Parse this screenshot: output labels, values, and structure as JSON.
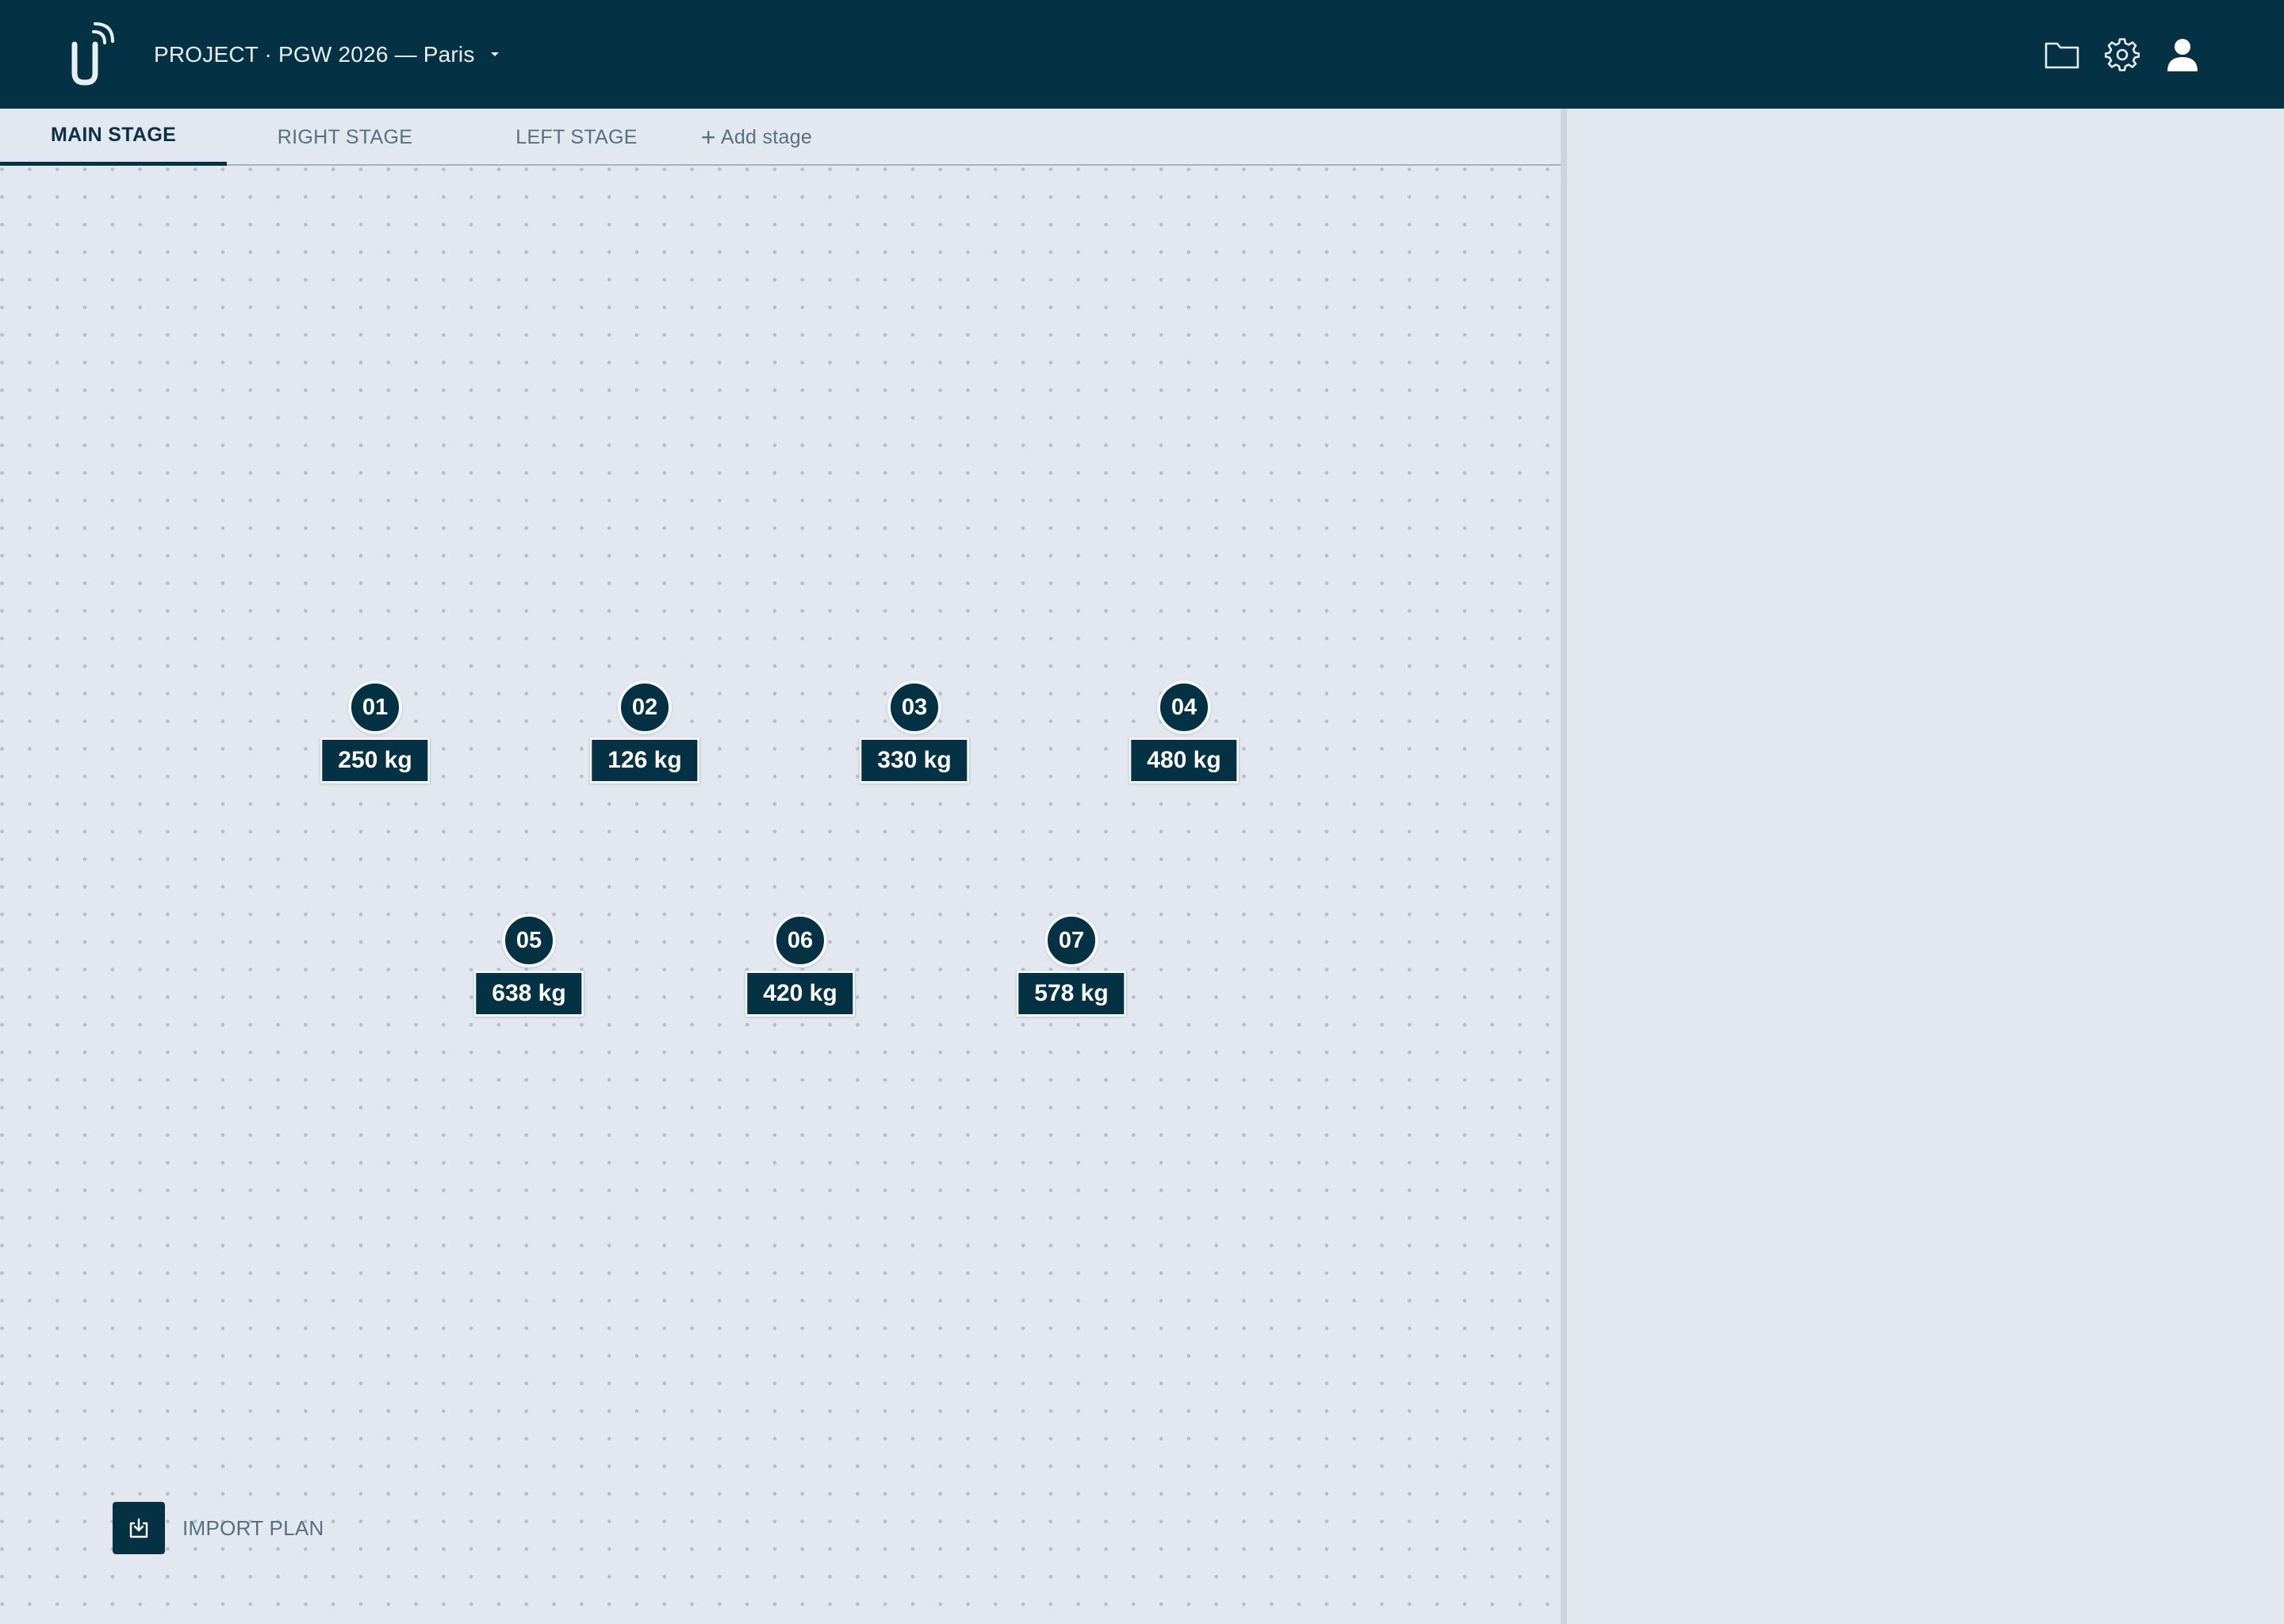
{
  "app": {
    "logo_icon": "app-logo-icon"
  },
  "project": {
    "title": "PROJECT · PGW 2026 — Paris",
    "dropdown_icon": "caret-down-icon"
  },
  "header_actions": [
    {
      "name": "folder-icon"
    },
    {
      "name": "gear-icon"
    },
    {
      "name": "user-icon"
    }
  ],
  "tabs": [
    {
      "label": "MAIN STAGE",
      "active": true
    },
    {
      "label": "RIGHT STAGE",
      "active": false
    },
    {
      "label": "LEFT STAGE",
      "active": false
    }
  ],
  "add_stage": {
    "plus": "+",
    "label": "Add stage"
  },
  "markers": [
    {
      "id": "01",
      "weight": "250 kg"
    },
    {
      "id": "02",
      "weight": "126 kg"
    },
    {
      "id": "03",
      "weight": "330 kg"
    },
    {
      "id": "04",
      "weight": "480 kg"
    },
    {
      "id": "05",
      "weight": "638 kg"
    },
    {
      "id": "06",
      "weight": "420 kg"
    },
    {
      "id": "07",
      "weight": "578 kg"
    }
  ],
  "import_plan": {
    "label": "IMPORT PLAN",
    "icon": "download-icon"
  },
  "colors": {
    "primary": "#043244",
    "background": "#e3e7ef",
    "muted_text": "#57707f",
    "divider": "#cdd4de"
  }
}
